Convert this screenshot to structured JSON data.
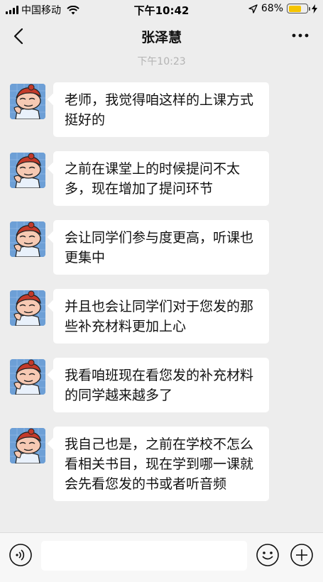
{
  "status_bar": {
    "carrier": "中国移动",
    "time": "下午10:42",
    "battery_percent": "68%",
    "battery_level": 0.68
  },
  "header": {
    "title": "张泽慧",
    "back_icon": "chevron-left-icon",
    "more_icon": "more-dots-icon"
  },
  "timestamp": "下午10:23",
  "messages": [
    {
      "text": "老师，我觉得咱这样的上课方式挺好的"
    },
    {
      "text": "之前在课堂上的时候提问不太多，现在增加了提问环节"
    },
    {
      "text": "会让同学们参与度更高，听课也更集中"
    },
    {
      "text": "并且也会让同学们对于您发的那些补充材料更加上心"
    },
    {
      "text": "我看咱班现在看您发的补充材料的同学越来越多了"
    },
    {
      "text": "我自己也是，之前在学校不怎么看相关书目，现在学到哪一课就会先看您发的书或者听音频"
    }
  ],
  "input_bar": {
    "voice_icon": "voice-icon",
    "emoji_icon": "emoji-icon",
    "add_icon": "plus-circle-icon",
    "input_value": ""
  },
  "colors": {
    "background": "#ededed",
    "bubble": "#ffffff",
    "battery": "#f5c400"
  }
}
